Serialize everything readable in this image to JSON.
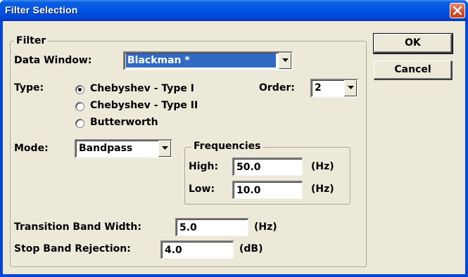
{
  "window": {
    "title": "Filter Selection"
  },
  "filter_group": {
    "legend": "Filter",
    "data_window": {
      "label": "Data Window:",
      "value": "Blackman *"
    },
    "type": {
      "label": "Type:",
      "options": [
        {
          "label": "Chebyshev - Type I",
          "checked": true
        },
        {
          "label": "Chebyshev - Type II",
          "checked": false
        },
        {
          "label": "Butterworth",
          "checked": false
        }
      ]
    },
    "order": {
      "label": "Order:",
      "value": "2"
    },
    "mode": {
      "label": "Mode:",
      "value": "Bandpass"
    },
    "frequencies": {
      "legend": "Frequencies",
      "high": {
        "label": "High:",
        "value": "50.0",
        "unit": "(Hz)"
      },
      "low": {
        "label": "Low:",
        "value": "10.0",
        "unit": "(Hz)"
      }
    },
    "transition_band_width": {
      "label": "Transition Band Width:",
      "value": "5.0",
      "unit": "(Hz)"
    },
    "stop_band_rejection": {
      "label": "Stop Band Rejection:",
      "value": "4.0",
      "unit": "(dB)"
    }
  },
  "buttons": {
    "ok": "OK",
    "cancel": "Cancel"
  },
  "icons": {
    "close": "close-icon",
    "dropdown": "chevron-down-icon"
  },
  "colors": {
    "titlebar": "#0255e3",
    "dialog_bg": "#ece9d8",
    "selection": "#316ac5",
    "close_button": "#d8502c"
  }
}
